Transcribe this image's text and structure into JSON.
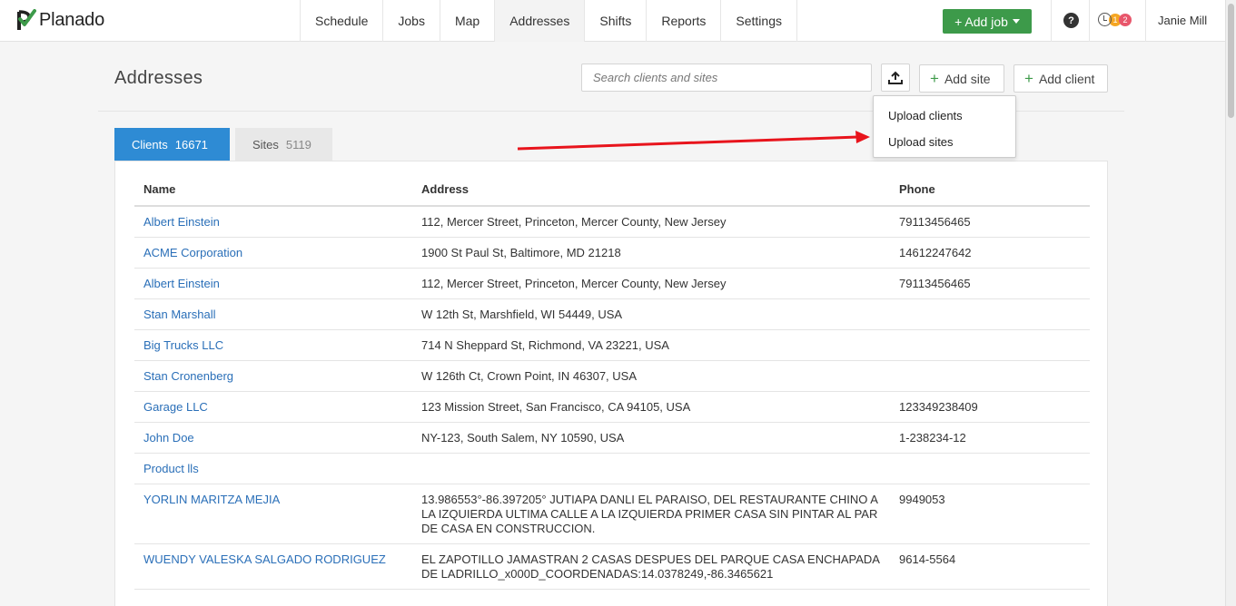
{
  "app": {
    "name": "Planado"
  },
  "nav": {
    "items": [
      {
        "label": "Schedule",
        "active": false
      },
      {
        "label": "Jobs",
        "active": false
      },
      {
        "label": "Map",
        "active": false
      },
      {
        "label": "Addresses",
        "active": true
      },
      {
        "label": "Shifts",
        "active": false
      },
      {
        "label": "Reports",
        "active": false
      },
      {
        "label": "Settings",
        "active": false
      }
    ],
    "add_job_label": "+ Add job",
    "help_label": "?",
    "badges": {
      "orange": "1",
      "red": "2"
    },
    "user_name": "Janie Mill"
  },
  "page": {
    "title": "Addresses",
    "search_placeholder": "Search clients and sites",
    "add_site_label": "Add site",
    "add_client_label": "Add client"
  },
  "upload_menu": {
    "items": [
      "Upload clients",
      "Upload sites"
    ]
  },
  "tabs": {
    "clients": {
      "label": "Clients",
      "count": "16671"
    },
    "sites": {
      "label": "Sites",
      "count": "5119"
    }
  },
  "table": {
    "headers": {
      "name": "Name",
      "address": "Address",
      "phone": "Phone"
    },
    "rows": [
      {
        "name": "Albert Einstein",
        "address": "112, Mercer Street, Princeton, Mercer County, New Jersey",
        "phone": "79113456465"
      },
      {
        "name": "ACME Corporation",
        "address": "1900 St Paul St, Baltimore, MD 21218",
        "phone": "14612247642"
      },
      {
        "name": "Albert Einstein",
        "address": "112, Mercer Street, Princeton, Mercer County, New Jersey",
        "phone": "79113456465"
      },
      {
        "name": "Stan Marshall",
        "address": "W 12th St, Marshfield, WI 54449, USA",
        "phone": ""
      },
      {
        "name": "Big Trucks LLC",
        "address": "714 N Sheppard St, Richmond, VA 23221, USA",
        "phone": ""
      },
      {
        "name": "Stan Cronenberg",
        "address": "W 126th Ct, Crown Point, IN 46307, USA",
        "phone": ""
      },
      {
        "name": "Garage LLC",
        "address": "123 Mission Street, San Francisco, CA 94105, USA",
        "phone": "123349238409"
      },
      {
        "name": "John Doe",
        "address": "NY-123, South Salem, NY 10590, USA",
        "phone": "1-238234-12"
      },
      {
        "name": "Product lls",
        "address": "",
        "phone": ""
      },
      {
        "name": "YORLIN MARITZA MEJIA",
        "address": "13.986553°-86.397205° JUTIAPA DANLI EL PARAISO, DEL RESTAURANTE CHINO A LA IZQUIERDA ULTIMA CALLE A LA IZQUIERDA PRIMER CASA SIN PINTAR AL PAR DE CASA EN CONSTRUCCION.",
        "phone": "9949053"
      },
      {
        "name": "WUENDY VALESKA SALGADO RODRIGUEZ",
        "address": "EL ZAPOTILLO JAMASTRAN 2 CASAS DESPUES DEL PARQUE CASA ENCHAPADA DE LADRILLO_x000D_COORDENADAS:14.0378249,-86.3465621",
        "phone": "9614-5564"
      }
    ]
  },
  "colors": {
    "brand_green": "#3d9a4a",
    "tab_active": "#2e8bd4",
    "link": "#2a6fb8",
    "annotation_arrow": "#e8141c"
  }
}
